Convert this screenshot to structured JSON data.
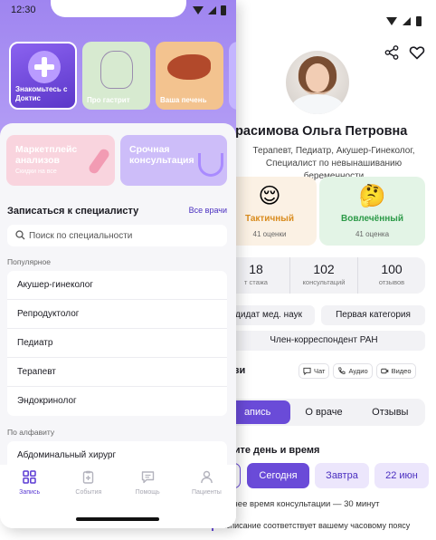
{
  "colors": {
    "accent": "#6a4bd8",
    "hero": "#a48bf2",
    "tactful": "#fbf1e4",
    "involved": "#e3f4e6"
  },
  "front": {
    "status_time": "12:30",
    "stories": [
      {
        "label": "Знакомьтесь с Доктис"
      },
      {
        "label": "Про гастрит"
      },
      {
        "label": "Ваша печень"
      }
    ],
    "promos": [
      {
        "title": "Маркетплейс анализов",
        "subtitle": "Скидки на все"
      },
      {
        "title": "Срочная консультация"
      }
    ],
    "specialist_section_title": "Записаться к специалисту",
    "all_doctors_link": "Все врачи",
    "search_placeholder": "Поиск по специальности",
    "popular_label": "Популярное",
    "popular": [
      "Акушер-гинеколог",
      "Репродуктолог",
      "Педиатр",
      "Терапевт",
      "Эндокринолог"
    ],
    "alpha_label": "По алфавиту",
    "alpha": [
      "Абдоминальный хирург"
    ],
    "tabs": [
      {
        "label": "Запись",
        "icon": "grid-icon"
      },
      {
        "label": "События",
        "icon": "clipboard-icon"
      },
      {
        "label": "Помощь",
        "icon": "chat-icon"
      },
      {
        "label": "Пациенты",
        "icon": "person-icon"
      }
    ]
  },
  "doctor": {
    "name": "ерасимова Ольга Петровна",
    "specialties": "Терапевт, Педиатр, Акушер-Гинеколог, Специалист по невынашиванию беременности",
    "ratings": [
      {
        "emoji": "😌",
        "title": "Тактичный",
        "count": "41 оценки"
      },
      {
        "emoji": "🤔",
        "title": "Вовлечённый",
        "count": "41 оценка"
      }
    ],
    "stats": [
      {
        "value": "18",
        "label": "т стажа"
      },
      {
        "value": "102",
        "label": "консультаций"
      },
      {
        "value": "100",
        "label": "отзывов"
      }
    ],
    "chips": [
      "дидат мед. наук",
      "Первая категория",
      "Член-корреспондент РАН"
    ],
    "comm_title": "вязи",
    "comm": [
      "Чат",
      "Аудио",
      "Видео"
    ],
    "segments": [
      "апись",
      "О враче",
      "Отзывы"
    ],
    "pick_title": "рите день и время",
    "days": [
      "",
      "Сегодня",
      "Завтра",
      "22 июн"
    ],
    "avg_time": "днее время консультации — 30 минут",
    "tz_note": "Расписание соответствует вашему часовому поясу"
  }
}
